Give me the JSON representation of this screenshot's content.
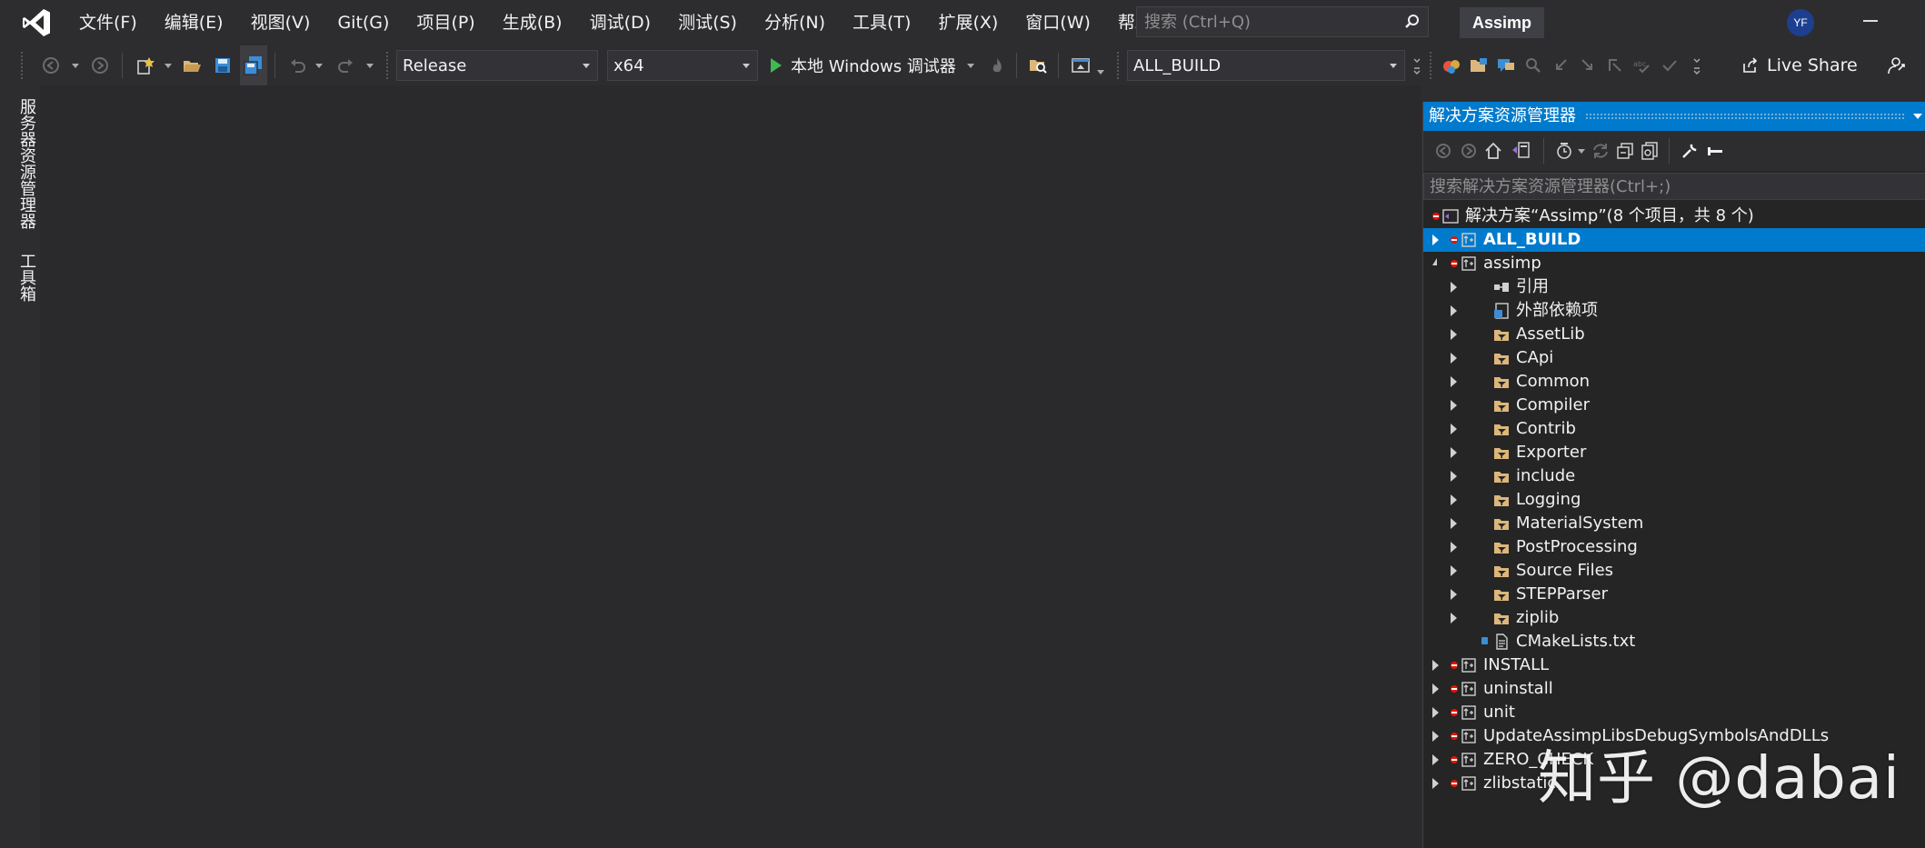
{
  "menubar": {
    "items": [
      "文件(F)",
      "编辑(E)",
      "视图(V)",
      "Git(G)",
      "项目(P)",
      "生成(B)",
      "调试(D)",
      "测试(S)",
      "分析(N)",
      "工具(T)",
      "扩展(X)",
      "窗口(W)",
      "帮助(H)"
    ],
    "search_placeholder": "搜索 (Ctrl+Q)",
    "solution_title": "Assimp",
    "avatar_initials": "YF"
  },
  "toolbar": {
    "configuration": "Release",
    "platform": "x64",
    "run_label": "本地 Windows 调试器",
    "startup_project": "ALL_BUILD",
    "live_share": "Live Share"
  },
  "left_tabs": {
    "servers": "服务器资源管理器",
    "toolbox": "工具箱"
  },
  "solution_explorer": {
    "title": "解决方案资源管理器",
    "search_placeholder": "搜索解决方案资源管理器(Ctrl+;)",
    "solution_label": "解决方案“Assimp”(8 个项目，共 8 个)",
    "tree": [
      {
        "label": "ALL_BUILD",
        "kind": "project",
        "state": "collapsed",
        "selected": true
      },
      {
        "label": "assimp",
        "kind": "project",
        "state": "expanded"
      },
      {
        "label": "引用",
        "kind": "references",
        "state": "collapsed"
      },
      {
        "label": "外部依赖项",
        "kind": "external",
        "state": "collapsed"
      },
      {
        "label": "AssetLib",
        "kind": "filter",
        "state": "collapsed"
      },
      {
        "label": "CApi",
        "kind": "filter",
        "state": "collapsed"
      },
      {
        "label": "Common",
        "kind": "filter",
        "state": "collapsed"
      },
      {
        "label": "Compiler",
        "kind": "filter",
        "state": "collapsed"
      },
      {
        "label": "Contrib",
        "kind": "filter",
        "state": "collapsed"
      },
      {
        "label": "Exporter",
        "kind": "filter",
        "state": "collapsed"
      },
      {
        "label": "include",
        "kind": "filter",
        "state": "collapsed"
      },
      {
        "label": "Logging",
        "kind": "filter",
        "state": "collapsed"
      },
      {
        "label": "MaterialSystem",
        "kind": "filter",
        "state": "collapsed"
      },
      {
        "label": "PostProcessing",
        "kind": "filter",
        "state": "collapsed"
      },
      {
        "label": "Source Files",
        "kind": "filter",
        "state": "collapsed"
      },
      {
        "label": "STEPParser",
        "kind": "filter",
        "state": "collapsed"
      },
      {
        "label": "ziplib",
        "kind": "filter",
        "state": "collapsed"
      },
      {
        "label": "CMakeLists.txt",
        "kind": "file",
        "state": "none"
      },
      {
        "label": "INSTALL",
        "kind": "project",
        "state": "collapsed"
      },
      {
        "label": "uninstall",
        "kind": "project",
        "state": "collapsed"
      },
      {
        "label": "unit",
        "kind": "project",
        "state": "collapsed"
      },
      {
        "label": "UpdateAssimpLibsDebugSymbolsAndDLLs",
        "kind": "project",
        "state": "collapsed"
      },
      {
        "label": "ZERO_CHECK",
        "kind": "project",
        "state": "collapsed"
      },
      {
        "label": "zlibstatic",
        "kind": "project",
        "state": "collapsed"
      }
    ]
  },
  "watermark": "知乎 @dabai",
  "colors": {
    "chrome": "#2d2d30",
    "editor": "#2a2a2c",
    "accent": "#007acc",
    "error_dot": "#e51400",
    "run_green": "#3fb950",
    "folder": "#dcb67a"
  }
}
